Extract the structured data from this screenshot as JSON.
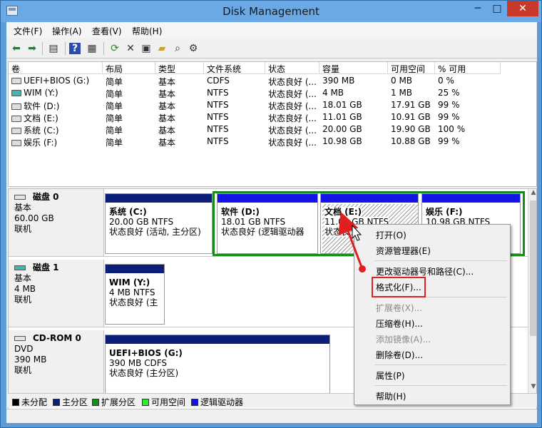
{
  "window": {
    "title": "Disk Management",
    "minimize": "─",
    "maximize": "□",
    "close": "✕"
  },
  "menu": [
    "文件(F)",
    "操作(A)",
    "查看(V)",
    "帮助(H)"
  ],
  "toolbar_icons": [
    "back-icon",
    "forward-icon",
    "grid-icon",
    "help-icon",
    "list-icon",
    "refresh-icon",
    "delete-icon",
    "properties-icon",
    "open-folder-icon",
    "search-icon",
    "settings-icon"
  ],
  "columns": [
    "卷",
    "布局",
    "类型",
    "文件系统",
    "状态",
    "容量",
    "可用空间",
    "% 可用"
  ],
  "volumes": [
    {
      "name": "UEFI+BIOS (G:)",
      "layout": "简单",
      "type": "基本",
      "fs": "CDFS",
      "status": "状态良好 (...",
      "capacity": "390 MB",
      "free": "0 MB",
      "pct": "0 %",
      "icon": "gray"
    },
    {
      "name": "WIM (Y:)",
      "layout": "简单",
      "type": "基本",
      "fs": "NTFS",
      "status": "状态良好 (...",
      "capacity": "4 MB",
      "free": "1 MB",
      "pct": "25 %",
      "icon": "teal"
    },
    {
      "name": "软件 (D:)",
      "layout": "简单",
      "type": "基本",
      "fs": "NTFS",
      "status": "状态良好 (...",
      "capacity": "18.01 GB",
      "free": "17.91 GB",
      "pct": "99 %",
      "icon": "gray"
    },
    {
      "name": "文档 (E:)",
      "layout": "简单",
      "type": "基本",
      "fs": "NTFS",
      "status": "状态良好 (...",
      "capacity": "11.01 GB",
      "free": "10.91 GB",
      "pct": "99 %",
      "icon": "gray"
    },
    {
      "name": "系统 (C:)",
      "layout": "简单",
      "type": "基本",
      "fs": "NTFS",
      "status": "状态良好 (...",
      "capacity": "20.00 GB",
      "free": "19.90 GB",
      "pct": "100 %",
      "icon": "gray"
    },
    {
      "name": "娱乐 (F:)",
      "layout": "简单",
      "type": "基本",
      "fs": "NTFS",
      "status": "状态良好 (...",
      "capacity": "10.98 GB",
      "free": "10.88 GB",
      "pct": "99 %",
      "icon": "gray"
    }
  ],
  "disks": [
    {
      "name": "磁盘 0",
      "type": "基本",
      "size": "60.00 GB",
      "state": "联机"
    },
    {
      "name": "磁盘 1",
      "type": "基本",
      "size": "4 MB",
      "state": "联机"
    },
    {
      "name": "CD-ROM 0",
      "type": "DVD",
      "size": "390 MB",
      "state": "联机"
    }
  ],
  "partitions": {
    "c": {
      "name": "系统 (C:)",
      "size": "20.00 GB NTFS",
      "status": "状态良好 (活动, 主分区)"
    },
    "d": {
      "name": "软件 (D:)",
      "size": "18.01 GB NTFS",
      "status": "状态良好 (逻辑驱动器"
    },
    "e": {
      "name": "文档 (E:)",
      "size": "11.01 GB NTFS",
      "status": "状态良"
    },
    "f": {
      "name": "娱乐 (F:)",
      "size": "10.98 GB NTFS"
    },
    "y": {
      "name": "WIM (Y:)",
      "size": "4 MB NTFS",
      "status": "状态良好 (主"
    },
    "g": {
      "name": "UEFI+BIOS (G:)",
      "size": "390 MB CDFS",
      "status": "状态良好 (主分区)"
    }
  },
  "legend": [
    {
      "label": "未分配",
      "color": "#000000"
    },
    {
      "label": "主分区",
      "color": "#0b1f7a"
    },
    {
      "label": "扩展分区",
      "color": "#1a8a1a"
    },
    {
      "label": "可用空间",
      "color": "#33e833"
    },
    {
      "label": "逻辑驱动器",
      "color": "#1414e8"
    }
  ],
  "context_menu": {
    "open": "打开(O)",
    "explorer": "资源管理器(E)",
    "change_letter": "更改驱动器号和路径(C)...",
    "format": "格式化(F)...",
    "extend": "扩展卷(X)...",
    "shrink": "压缩卷(H)...",
    "mirror": "添加镜像(A)...",
    "delete": "删除卷(D)...",
    "properties": "属性(P)",
    "help": "帮助(H)"
  }
}
